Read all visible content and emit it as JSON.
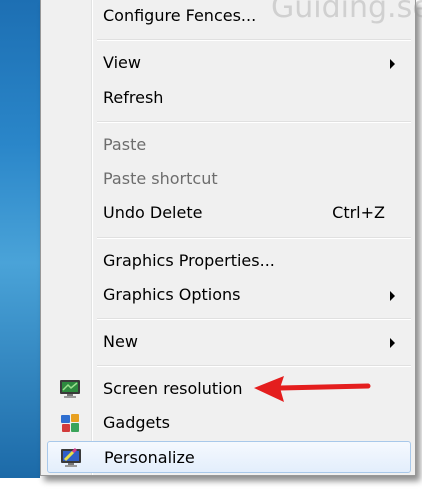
{
  "watermark": "Guiding.seen.com",
  "menu": {
    "items": [
      {
        "label": "Configure Fences..."
      },
      {
        "label": "View",
        "submenu": true
      },
      {
        "label": "Refresh"
      },
      {
        "label": "Paste",
        "disabled": true
      },
      {
        "label": "Paste shortcut",
        "disabled": true
      },
      {
        "label": "Undo Delete",
        "shortcut": "Ctrl+Z"
      },
      {
        "label": "Graphics Properties..."
      },
      {
        "label": "Graphics Options",
        "submenu": true
      },
      {
        "label": "New",
        "submenu": true
      },
      {
        "label": "Screen resolution",
        "icon": "screen-resolution-icon"
      },
      {
        "label": "Gadgets",
        "icon": "gadgets-icon"
      },
      {
        "label": "Personalize",
        "icon": "personalize-icon",
        "highlighted": true
      }
    ]
  },
  "annotation": {
    "color": "#e41e1e",
    "target": "Screen resolution"
  }
}
